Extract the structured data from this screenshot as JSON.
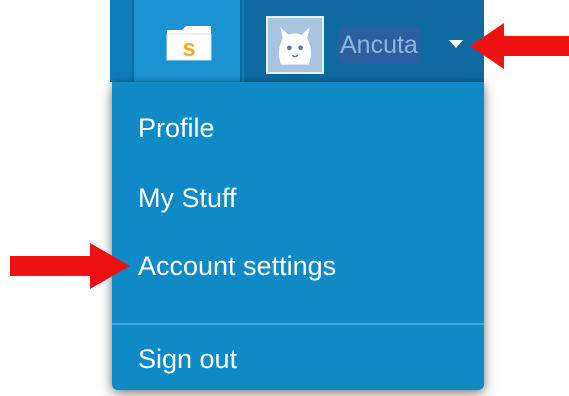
{
  "navbar": {
    "user_name": "Ancuta"
  },
  "dropdown": {
    "items": [
      {
        "label": "Profile"
      },
      {
        "label": "My Stuff"
      },
      {
        "label": "Account settings"
      },
      {
        "label": "Sign out"
      }
    ]
  },
  "colors": {
    "navbar": "#0f7dbb",
    "menu": "#0f8ac7",
    "arrow": "#ee1111",
    "folder": "#f5a623"
  },
  "icons": {
    "mystuff": "folder-icon",
    "avatar": "cat-avatar-icon",
    "caret": "caret-down-icon",
    "annotation": "red-arrow-icon"
  }
}
